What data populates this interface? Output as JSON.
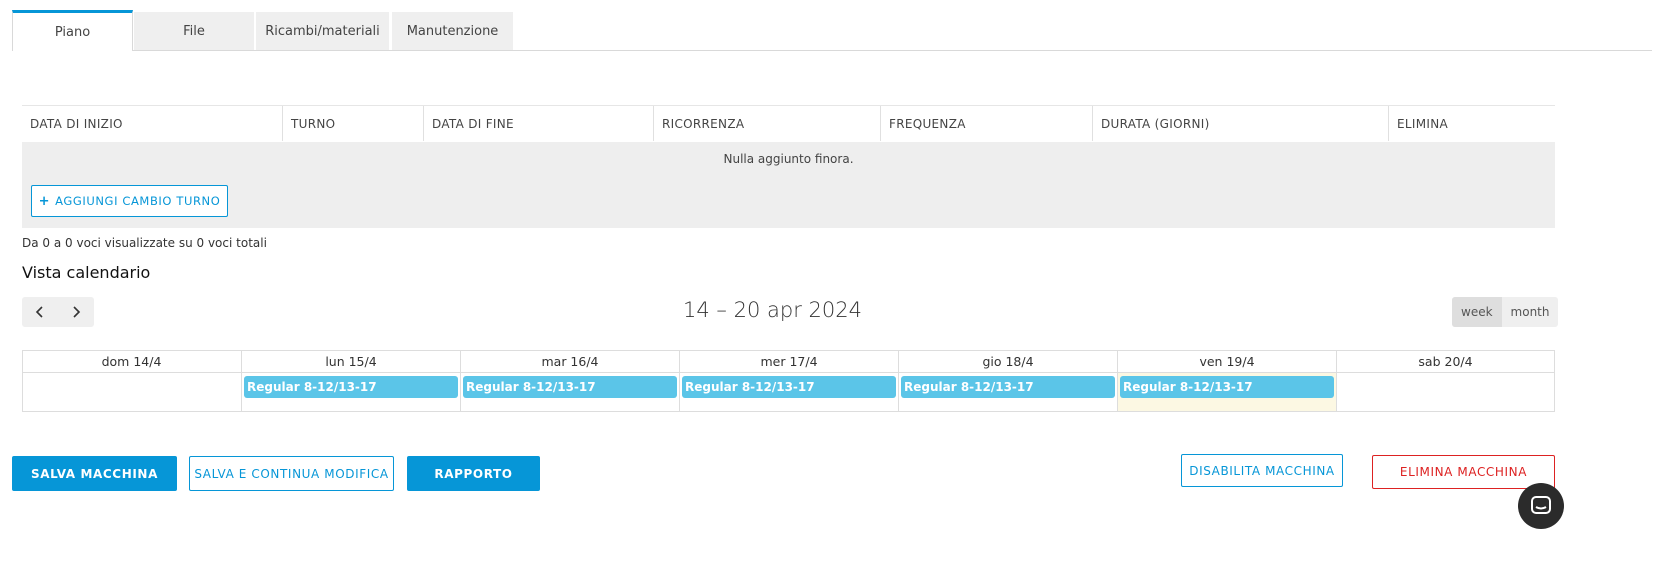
{
  "tabs": [
    "Piano",
    "File",
    "Ricambi/materiali",
    "Manutenzione"
  ],
  "table": {
    "headers": [
      "DATA DI INIZIO",
      "TURNO",
      "DATA DI FINE",
      "RICORRENZA",
      "FREQUENZA",
      "DURATA (GIORNI)",
      "ELIMINA"
    ],
    "empty_message": "Nulla aggiunto finora.",
    "add_button": "AGGIUNGI CAMBIO TURNO",
    "summary": "Da 0 a 0 voci visualizzate su 0 voci totali"
  },
  "calendar": {
    "title": "Vista calendario",
    "range": "14 – 20 apr 2024",
    "views": [
      "week",
      "month"
    ],
    "active_view": "week",
    "days": [
      "dom 14/4",
      "lun 15/4",
      "mar 16/4",
      "mer 17/4",
      "gio 18/4",
      "ven 19/4",
      "sab 20/4"
    ],
    "events": [
      "",
      "Regular 8-12/13-17",
      "Regular 8-12/13-17",
      "Regular 8-12/13-17",
      "Regular 8-12/13-17",
      "Regular 8-12/13-17",
      ""
    ],
    "today_label": "ven 19/4"
  },
  "actions": {
    "save": "SALVA MACCHINA",
    "save_continue": "SALVA E CONTINUA MODIFICA",
    "report": "RAPPORTO",
    "disable": "DISABILITA MACCHINA",
    "delete": "ELIMINA MACCHINA"
  },
  "colors": {
    "accent": "#0696d7",
    "event": "#5bc5e8",
    "danger": "#dd2222",
    "today": "#fcf8e3"
  }
}
